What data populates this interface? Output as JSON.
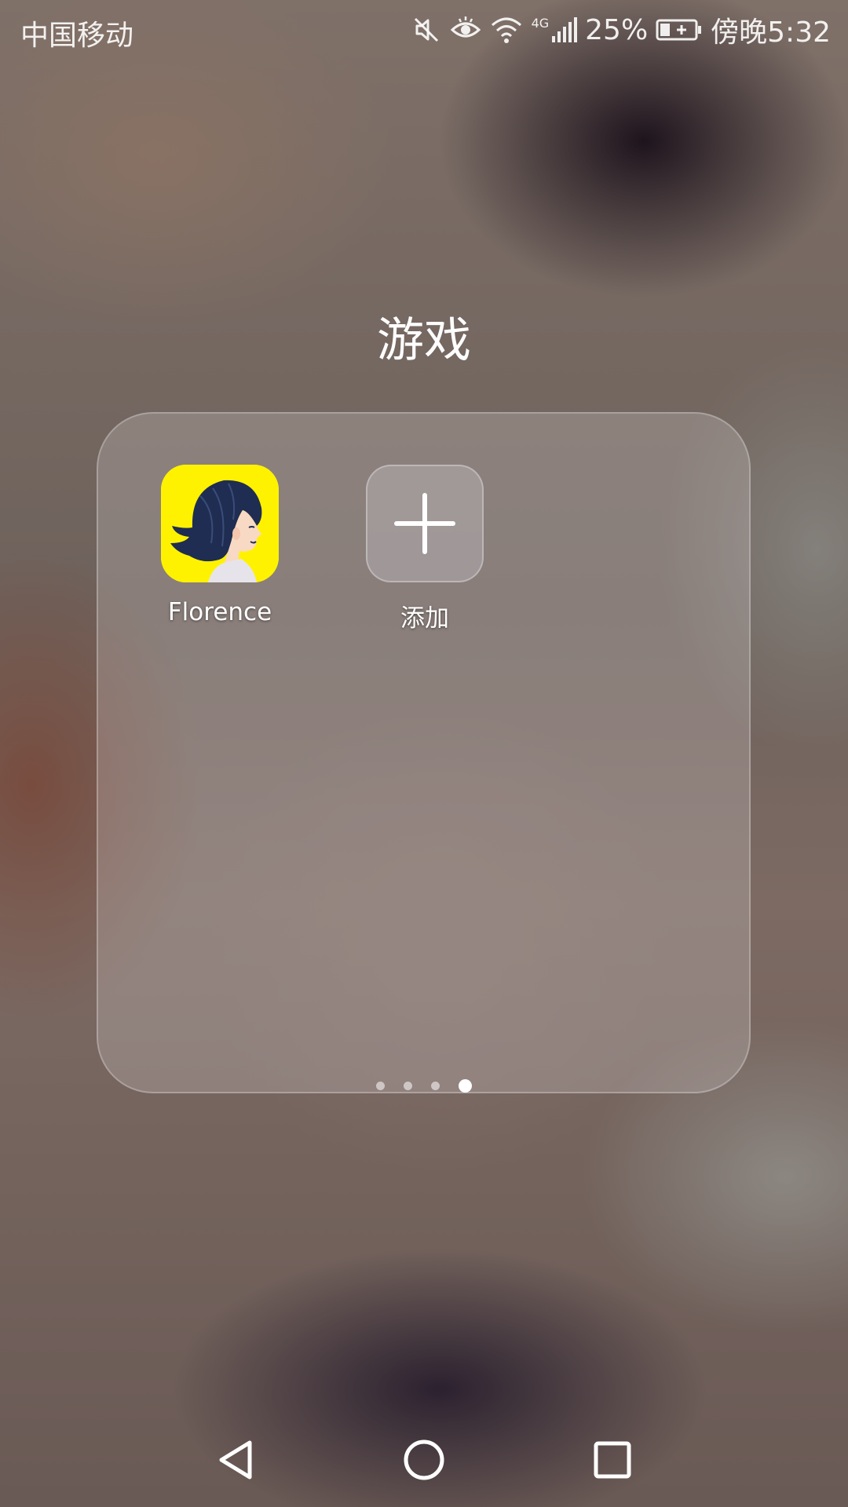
{
  "status_bar": {
    "carrier": "中国移动",
    "network_type": "4G",
    "battery_percent": "25%",
    "time": "傍晚5:32",
    "icons": [
      "mute-icon",
      "eye-comfort-icon",
      "wifi-icon",
      "signal-icon",
      "battery-charging-icon"
    ]
  },
  "folder": {
    "title": "游戏",
    "apps": [
      {
        "label": "Florence",
        "icon": "florence-app-icon",
        "icon_color": "#fff200"
      },
      {
        "label": "添加",
        "icon": "plus-icon"
      }
    ],
    "pages": {
      "count": 4,
      "active_index": 3
    }
  },
  "nav_bar": {
    "buttons": [
      "back-icon",
      "home-icon",
      "recents-icon"
    ]
  }
}
